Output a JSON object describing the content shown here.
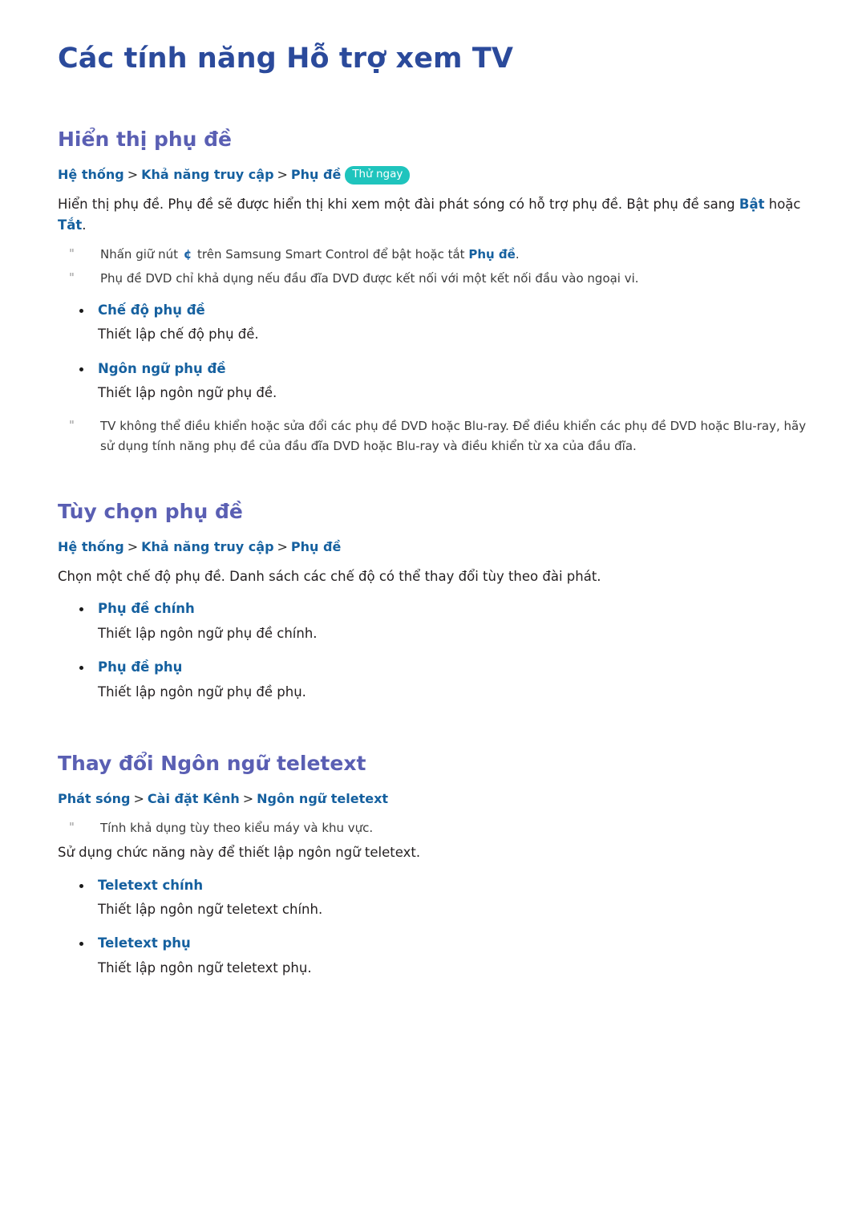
{
  "page": {
    "title": "Các tính năng Hỗ trợ xem TV",
    "colors": {
      "title": "#2b4a9b",
      "section_heading": "#5a5fb3",
      "link_blue": "#15609f",
      "badge_teal": "#1fc4bd",
      "body_text": "#231f20",
      "note_text": "#3b3b3b",
      "note_mark": "#9a9a9a"
    }
  },
  "sections": [
    {
      "heading": "Hiển thị phụ đề",
      "breadcrumb": {
        "crumbs": [
          "Hệ thống",
          "Khả năng truy cập",
          "Phụ đề"
        ],
        "separator": ">",
        "badge": "Thử ngay"
      },
      "paragraph_pre": "Hiển thị phụ đề. Phụ đề sẽ được hiển thị khi xem một đài phát sóng có hỗ trợ phụ đề. Bật phụ đề sang ",
      "paragraph_term1": "Bật",
      "paragraph_mid": " hoặc ",
      "paragraph_term2": "Tắt",
      "paragraph_post": ".",
      "notes_top": [
        {
          "mark": "\"",
          "pre": "Nhấn giữ nút ",
          "glyph": "¢",
          "mid": " trên Samsung Smart Control để bật hoặc tắt ",
          "term": "Phụ đề",
          "post": "."
        },
        {
          "mark": "\"",
          "text": "Phụ đề DVD chỉ khả dụng nếu đầu đĩa DVD được kết nối với một kết nối đầu vào ngoại vi."
        }
      ],
      "bullets": [
        {
          "label": "Chế độ phụ đề",
          "desc": "Thiết lập chế độ phụ đề."
        },
        {
          "label": "Ngôn ngữ phụ đề",
          "desc": "Thiết lập ngôn ngữ phụ đề."
        }
      ],
      "notes_bottom": [
        {
          "mark": "\"",
          "text": "TV không thể điều khiển hoặc sửa đổi các phụ đề DVD hoặc Blu-ray. Để điều khiển các phụ đề DVD hoặc Blu-ray, hãy sử dụng tính năng phụ đề của đầu đĩa DVD hoặc Blu-ray và điều khiển từ xa của đầu đĩa."
        }
      ]
    },
    {
      "heading": "Tùy chọn phụ đề",
      "breadcrumb": {
        "crumbs": [
          "Hệ thống",
          "Khả năng truy cập",
          "Phụ đề"
        ],
        "separator": ">",
        "badge": ""
      },
      "paragraph": "Chọn một chế độ phụ đề. Danh sách các chế độ có thể thay đổi tùy theo đài phát.",
      "bullets": [
        {
          "label": "Phụ đề chính",
          "desc": "Thiết lập ngôn ngữ phụ đề chính."
        },
        {
          "label": "Phụ đề phụ",
          "desc": "Thiết lập ngôn ngữ phụ đề phụ."
        }
      ]
    },
    {
      "heading": "Thay đổi Ngôn ngữ teletext",
      "breadcrumb": {
        "crumbs": [
          "Phát sóng",
          "Cài đặt Kênh",
          "Ngôn ngữ teletext"
        ],
        "separator": ">",
        "badge": ""
      },
      "note": {
        "mark": "\"",
        "text": "Tính khả dụng tùy theo kiểu máy và khu vực."
      },
      "paragraph": "Sử dụng chức năng này để thiết lập ngôn ngữ teletext.",
      "bullets": [
        {
          "label": "Teletext chính",
          "desc": "Thiết lập ngôn ngữ teletext chính."
        },
        {
          "label": "Teletext phụ",
          "desc": "Thiết lập ngôn ngữ teletext phụ."
        }
      ]
    }
  ]
}
